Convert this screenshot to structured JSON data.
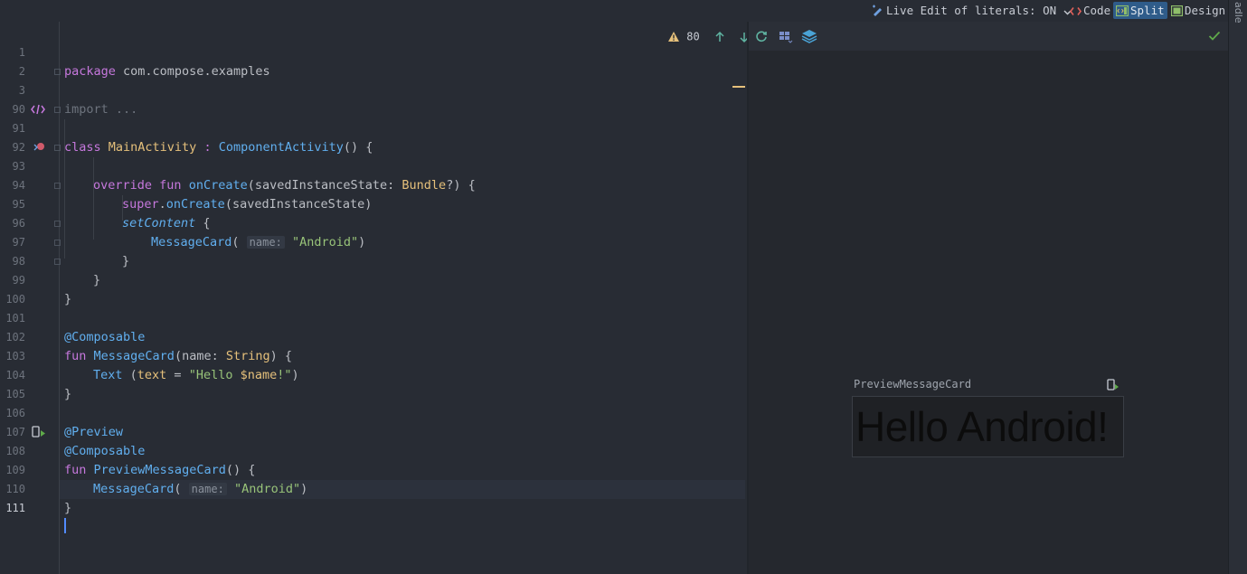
{
  "toolbar": {
    "live_edit": "Live Edit of literals: ON",
    "code": "Code",
    "split": "Split",
    "design": "Design"
  },
  "editor": {
    "warning_count": "80",
    "lines": [
      {
        "n": "1"
      },
      {
        "n": "2"
      },
      {
        "n": "3"
      },
      {
        "n": "90"
      },
      {
        "n": "91"
      },
      {
        "n": "92"
      },
      {
        "n": "93"
      },
      {
        "n": "94"
      },
      {
        "n": "95"
      },
      {
        "n": "96"
      },
      {
        "n": "97"
      },
      {
        "n": "98"
      },
      {
        "n": "99"
      },
      {
        "n": "100"
      },
      {
        "n": "101"
      },
      {
        "n": "102"
      },
      {
        "n": "103"
      },
      {
        "n": "104"
      },
      {
        "n": "105"
      },
      {
        "n": "106"
      },
      {
        "n": "107"
      },
      {
        "n": "108"
      },
      {
        "n": "109"
      },
      {
        "n": "110"
      },
      {
        "n": "111"
      }
    ],
    "code": {
      "l1_kw": "package",
      "l1_rest": " com.compose.examples",
      "l3": "import ...",
      "l91_kw": "class",
      "l91_name": "MainActivity",
      "l91_sep": " : ",
      "l91_super": "ComponentActivity",
      "l91_end": "() {",
      "l93_kw": "override fun",
      "l93_fn": "onCreate",
      "l93_a": "(savedInstanceState: ",
      "l93_ty": "Bundle",
      "l93_b": "?) {",
      "l94_kw": "super",
      "l94_a": ".",
      "l94_fn": "onCreate",
      "l94_b": "(savedInstanceState)",
      "l95_fn": "setContent",
      "l95_b": " {",
      "l96_fn": "MessageCard",
      "l96_a": "( ",
      "l96_hint": "name:",
      "l96_str": "\"Android\"",
      "l96_b": ")",
      "l97": "}",
      "l98": "}",
      "l99": "}",
      "l101": "@Composable",
      "l102_kw": "fun",
      "l102_fn": "MessageCard",
      "l102_a": "(name: ",
      "l102_ty": "String",
      "l102_b": ") {",
      "l103_fn": "Text",
      "l103_a": " (",
      "l103_param": "text",
      "l103_eq": " = ",
      "l103_str1": "\"Hello ",
      "l103_var": "$name",
      "l103_str2": "!\"",
      "l103_b": ")",
      "l104": "}",
      "l106": "@Preview",
      "l107": "@Composable",
      "l108_kw": "fun",
      "l108_fn": "PreviewMessageCard",
      "l108_b": "() {",
      "l109_fn": "MessageCard",
      "l109_a": "( ",
      "l109_hint": "name:",
      "l109_str": "\"Android\"",
      "l109_b": ")",
      "l110": "}"
    }
  },
  "preview": {
    "label": "PreviewMessageCard",
    "card_text": "Hello Android!"
  },
  "right_strip": {
    "label": "adle"
  },
  "colors": {
    "accent": "#2f5c8a",
    "warning": "#e5c07b",
    "check": "#5faa4a"
  }
}
